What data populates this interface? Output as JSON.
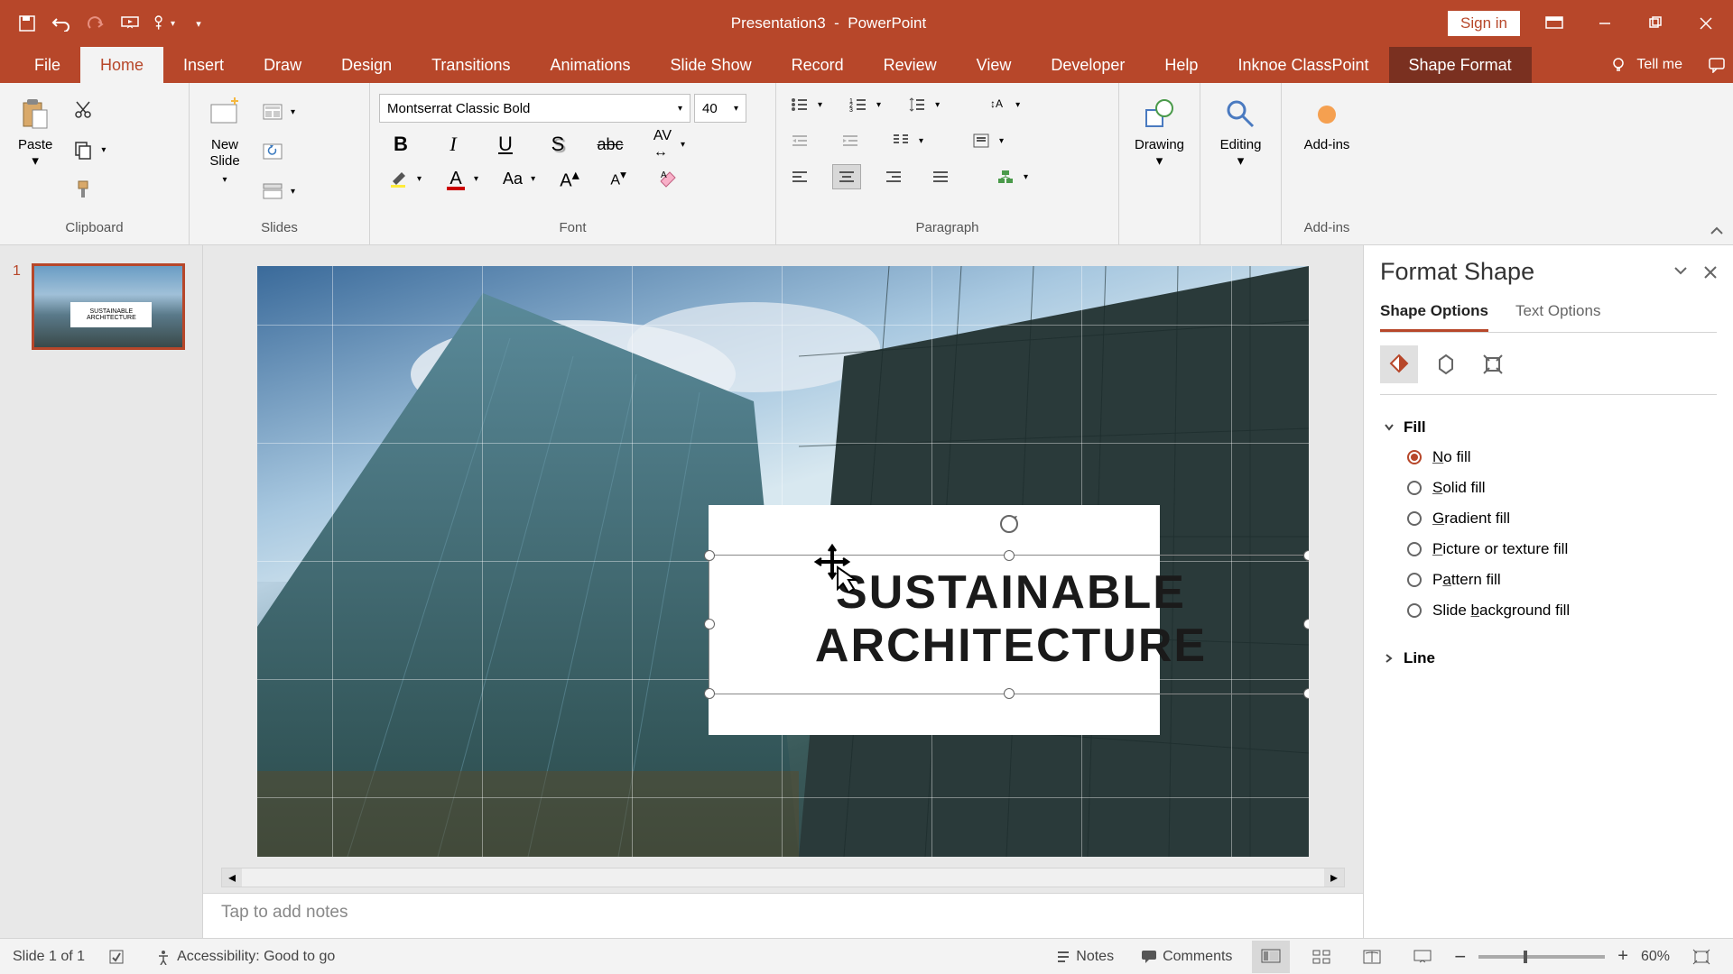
{
  "title_bar": {
    "document": "Presentation3",
    "app": "PowerPoint",
    "signin": "Sign in"
  },
  "tabs": {
    "file": "File",
    "home": "Home",
    "insert": "Insert",
    "draw": "Draw",
    "design": "Design",
    "transitions": "Transitions",
    "animations": "Animations",
    "slideshow": "Slide Show",
    "record": "Record",
    "review": "Review",
    "view": "View",
    "developer": "Developer",
    "help": "Help",
    "classpoint": "Inknoe ClassPoint",
    "shapeformat": "Shape Format",
    "tellme": "Tell me"
  },
  "ribbon": {
    "clipboard": {
      "label": "Clipboard",
      "paste": "Paste"
    },
    "slides": {
      "label": "Slides",
      "newslide": "New\nSlide"
    },
    "font": {
      "label": "Font",
      "name": "Montserrat Classic Bold",
      "size": "40"
    },
    "paragraph": {
      "label": "Paragraph"
    },
    "drawing": {
      "label": "Drawing"
    },
    "editing": {
      "label": "Editing"
    },
    "addins": {
      "label": "Add-ins",
      "btn": "Add-ins"
    }
  },
  "thumb": {
    "num": "1",
    "text": "SUSTAINABLE\nARCHITECTURE"
  },
  "slide": {
    "line1": "SUSTAINABLE",
    "line2": "ARCHITECTURE"
  },
  "notes": {
    "placeholder": "Tap to add notes"
  },
  "format_pane": {
    "title": "Format Shape",
    "tab_shape": "Shape Options",
    "tab_text": "Text Options",
    "fill": {
      "label": "Fill",
      "nofill": "No fill",
      "solid": "Solid fill",
      "gradient": "Gradient fill",
      "picture": "Picture or texture fill",
      "pattern": "Pattern fill",
      "bg": "Slide background fill"
    },
    "line": {
      "label": "Line"
    }
  },
  "status": {
    "slide": "Slide 1 of 1",
    "accessibility": "Accessibility: Good to go",
    "notes": "Notes",
    "comments": "Comments",
    "zoom": "60%"
  }
}
